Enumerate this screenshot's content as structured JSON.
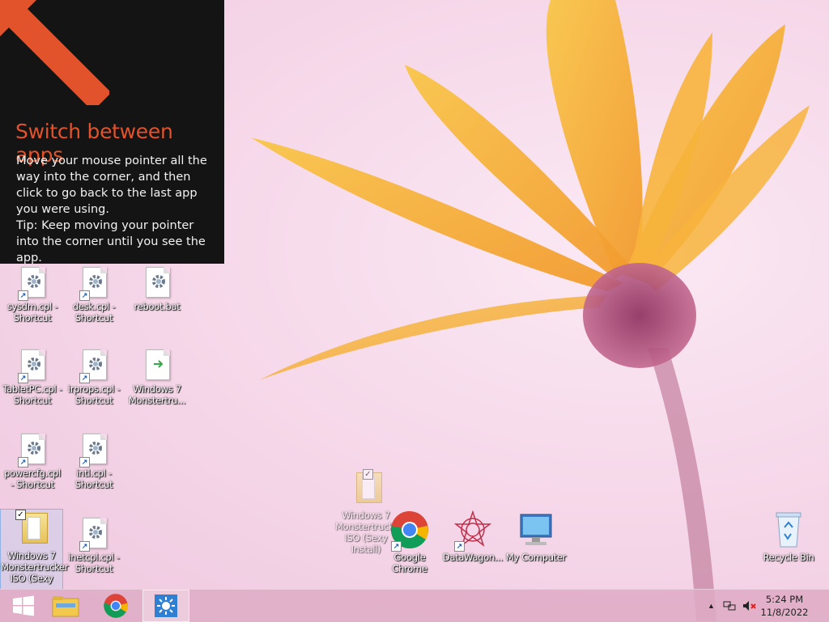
{
  "tip": {
    "title": "Switch between apps",
    "line1": "Move your mouse pointer all the way into the corner, and then click to go back to the last app you were using.",
    "line2": "Tip: Keep moving your pointer into the corner until you see the app.",
    "accent_color": "#e2522b"
  },
  "desktop_icons": {
    "sysdm": {
      "label": "sysdm.cpl - Shortcut",
      "icon": "cpl-gear-icon"
    },
    "desk": {
      "label": "desk.cpl - Shortcut",
      "icon": "cpl-gear-icon"
    },
    "reboot": {
      "label": "reboot.bat",
      "icon": "bat-gear-icon"
    },
    "tabletpc": {
      "label": "TabletPC.cpl - Shortcut",
      "icon": "cpl-gear-icon"
    },
    "irprops": {
      "label": "irprops.cpl - Shortcut",
      "icon": "cpl-gear-icon"
    },
    "win7_file": {
      "label": "Windows 7 Monstertru...",
      "icon": "file-icon"
    },
    "powercfg": {
      "label": "powercfg.cpl - Shortcut",
      "icon": "cpl-gear-icon"
    },
    "intl": {
      "label": "intl.cpl - Shortcut",
      "icon": "cpl-gear-icon"
    },
    "win7_folder_selected": {
      "label": "Windows 7 Monstertrucker ISO (Sexy",
      "icon": "folder-icon"
    },
    "inetcpl": {
      "label": "inetcpl.cpl - Shortcut",
      "icon": "cpl-gear-icon"
    },
    "win7_folder_drag": {
      "label": "Windows 7 Monstertrucker ISO (Sexy Install)",
      "icon": "folder-icon"
    },
    "chrome": {
      "label": "Google Chrome",
      "icon": "chrome-icon"
    },
    "datawagon": {
      "label": "DataWagon...",
      "icon": "datawagon-icon"
    },
    "mycomputer": {
      "label": "My Computer",
      "icon": "computer-icon"
    },
    "recyclebin": {
      "label": "Recycle Bin",
      "icon": "recycle-bin-icon"
    }
  },
  "taskbar": {
    "start": "start-icon",
    "pinned": [
      "file-explorer-icon",
      "chrome-icon",
      "active-app-icon"
    ],
    "tray": {
      "show_hidden": "▲",
      "network": "network-icon",
      "volume": "volume-muted-icon"
    },
    "time": "5:24 PM",
    "date": "11/8/2022"
  }
}
